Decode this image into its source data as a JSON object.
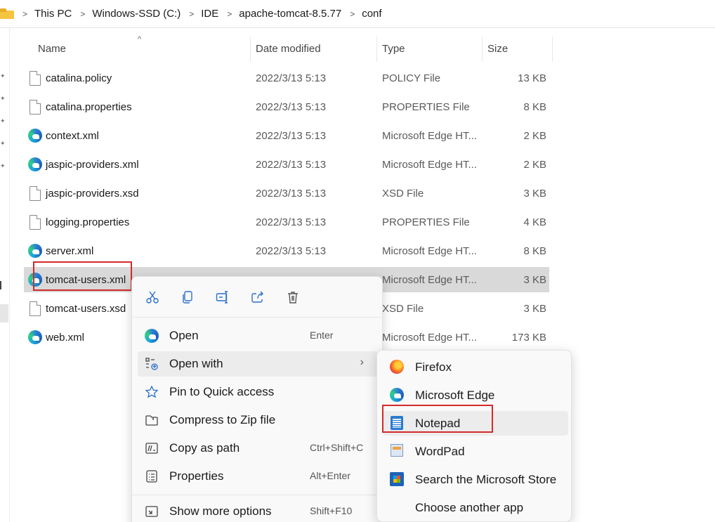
{
  "breadcrumb": {
    "items": [
      "This PC",
      "Windows-SSD (C:)",
      "IDE",
      "apache-tomcat-8.5.77",
      "conf"
    ],
    "separator": ">"
  },
  "columns": {
    "name": "Name",
    "date": "Date modified",
    "type": "Type",
    "size": "Size"
  },
  "files": [
    {
      "name": "catalina.policy",
      "date": "2022/3/13 5:13",
      "type": "POLICY File",
      "size": "13 KB",
      "icon": "document-icon"
    },
    {
      "name": "catalina.properties",
      "date": "2022/3/13 5:13",
      "type": "PROPERTIES File",
      "size": "8 KB",
      "icon": "document-icon"
    },
    {
      "name": "context.xml",
      "date": "2022/3/13 5:13",
      "type": "Microsoft Edge HT...",
      "size": "2 KB",
      "icon": "edge-icon"
    },
    {
      "name": "jaspic-providers.xml",
      "date": "2022/3/13 5:13",
      "type": "Microsoft Edge HT...",
      "size": "2 KB",
      "icon": "edge-icon"
    },
    {
      "name": "jaspic-providers.xsd",
      "date": "2022/3/13 5:13",
      "type": "XSD File",
      "size": "3 KB",
      "icon": "document-icon"
    },
    {
      "name": "logging.properties",
      "date": "2022/3/13 5:13",
      "type": "PROPERTIES File",
      "size": "4 KB",
      "icon": "document-icon"
    },
    {
      "name": "server.xml",
      "date": "2022/3/13 5:13",
      "type": "Microsoft Edge HT...",
      "size": "8 KB",
      "icon": "edge-icon"
    },
    {
      "name": "tomcat-users.xml",
      "date": "",
      "type": "Microsoft Edge HT...",
      "size": "3 KB",
      "icon": "edge-icon",
      "selected": true
    },
    {
      "name": "tomcat-users.xsd",
      "date": "",
      "type": "XSD File",
      "size": "3 KB",
      "icon": "document-icon"
    },
    {
      "name": "web.xml",
      "date": "",
      "type": "Microsoft Edge HT...",
      "size": "173 KB",
      "icon": "edge-icon"
    }
  ],
  "context_menu": {
    "toolbar": [
      "cut-icon",
      "copy-icon",
      "rename-icon",
      "share-icon",
      "delete-icon"
    ],
    "items": [
      {
        "label": "Open",
        "shortcut": "Enter",
        "icon": "edge-icon"
      },
      {
        "label": "Open with",
        "shortcut": "",
        "icon": "open-with-icon",
        "submenu": true
      },
      {
        "label": "Pin to Quick access",
        "shortcut": "",
        "icon": "star-icon"
      },
      {
        "label": "Compress to Zip file",
        "shortcut": "",
        "icon": "zip-folder-icon"
      },
      {
        "label": "Copy as path",
        "shortcut": "Ctrl+Shift+C",
        "icon": "copy-path-icon"
      },
      {
        "label": "Properties",
        "shortcut": "Alt+Enter",
        "icon": "properties-icon"
      },
      {
        "label": "Show more options",
        "shortcut": "Shift+F10",
        "icon": "more-options-icon"
      }
    ]
  },
  "open_with_menu": {
    "items": [
      {
        "label": "Firefox",
        "icon": "firefox-icon"
      },
      {
        "label": "Microsoft Edge",
        "icon": "edge-icon"
      },
      {
        "label": "Notepad",
        "icon": "notepad-icon"
      },
      {
        "label": "WordPad",
        "icon": "wordpad-icon"
      },
      {
        "label": "Search the Microsoft Store",
        "icon": "store-icon"
      },
      {
        "label": "Choose another app",
        "icon": ""
      }
    ]
  },
  "colors": {
    "highlight_box": "#d42a2a",
    "selected_row": "#d9d9d9",
    "menu_bg": "#f9f9f9"
  }
}
